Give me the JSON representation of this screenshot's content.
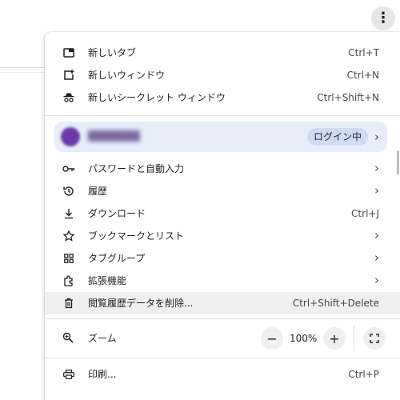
{
  "menu": {
    "new_tab": {
      "label": "新しいタブ",
      "shortcut": "Ctrl+T"
    },
    "new_window": {
      "label": "新しいウィンドウ",
      "shortcut": "Ctrl+N"
    },
    "incognito": {
      "label": "新しいシークレット ウィンドウ",
      "shortcut": "Ctrl+Shift+N"
    },
    "profile": {
      "status": "ログイン中"
    },
    "passwords": {
      "label": "パスワードと自動入力"
    },
    "history": {
      "label": "履歴"
    },
    "downloads": {
      "label": "ダウンロード",
      "shortcut": "Ctrl+J"
    },
    "bookmarks": {
      "label": "ブックマークとリスト"
    },
    "tab_groups": {
      "label": "タブグループ"
    },
    "extensions": {
      "label": "拡張機能"
    },
    "clear_data": {
      "label": "閲覧履歴データを削除...",
      "shortcut": "Ctrl+Shift+Delete"
    },
    "zoom": {
      "label": "ズーム",
      "value": "100%"
    },
    "print": {
      "label": "印刷...",
      "shortcut": "Ctrl+P"
    }
  },
  "colors": {
    "profile_bg": "#e7eefa",
    "badge_bg": "#cfdcf3",
    "highlight_bg": "#efefef"
  }
}
